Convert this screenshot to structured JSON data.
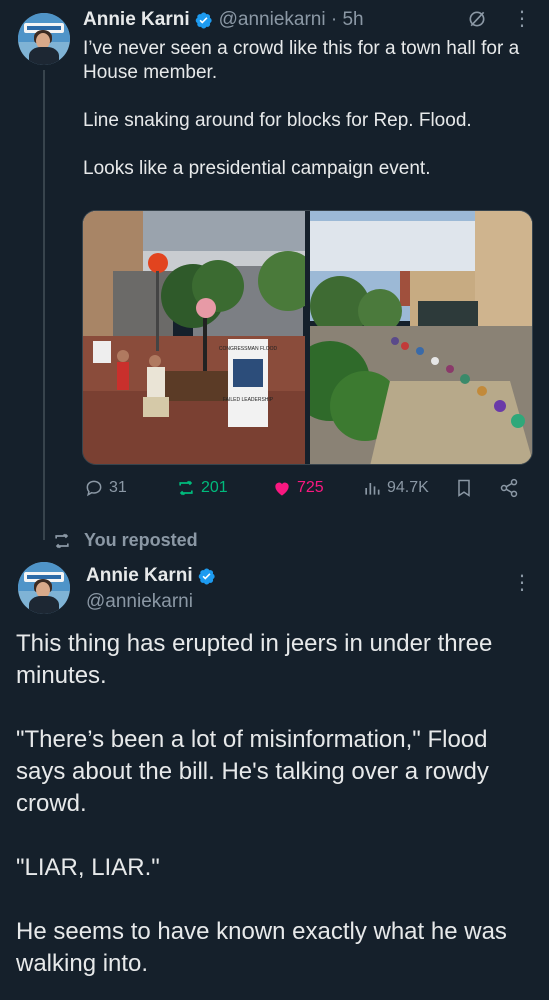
{
  "tweet1": {
    "author_name": "Annie Karni",
    "handle_time": "@anniekarni · 5h",
    "text": [
      "I’ve never seen a crowd like this for a town hall for a House member.",
      "Line snaking around for blocks for Rep. Flood.",
      "Looks like a presidential campaign event."
    ],
    "sign_text": {
      "top": "CONGRESSMAN FLOOD",
      "bottom": "FAILED LEADERSHIP"
    },
    "actions": {
      "replies": "31",
      "reposts": "201",
      "likes": "725",
      "views": "94.7K"
    }
  },
  "repost_label": "You reposted",
  "tweet2": {
    "author_name": "Annie Karni",
    "handle": "@anniekarni",
    "text": [
      "This thing has erupted in jeers in under three minutes.",
      "\"There’s been a lot of misinformation,\" Flood says about the bill. He's talking over a rowdy crowd.",
      "\"LIAR, LIAR.\"",
      "He seems to have known exactly what he was walking into."
    ]
  },
  "colors": {
    "background": "#15202b",
    "text": "#e7e9ea",
    "muted": "#8b98a5",
    "verified": "#1d9bf0",
    "repost_active": "#00ba7c",
    "like_active": "#f91880"
  },
  "icons": [
    "verified-badge-icon",
    "grok-icon",
    "more-icon",
    "reply-icon",
    "repost-icon",
    "like-icon",
    "views-icon",
    "bookmark-icon",
    "share-icon"
  ]
}
